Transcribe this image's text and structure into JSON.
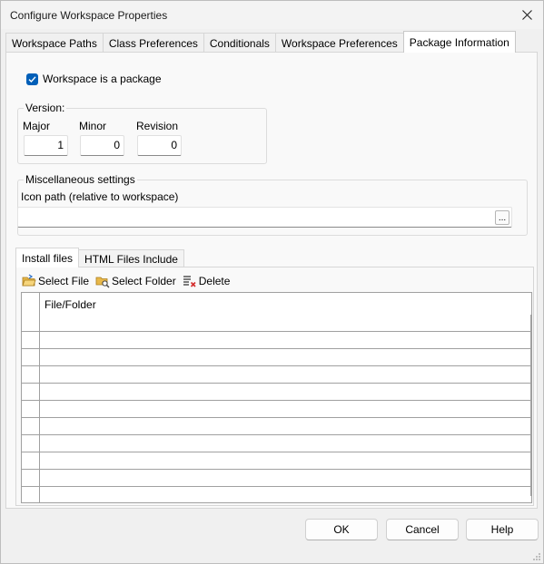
{
  "window": {
    "title": "Configure Workspace Properties"
  },
  "tabs": [
    {
      "label": "Workspace Paths",
      "active": false
    },
    {
      "label": "Class Preferences",
      "active": false
    },
    {
      "label": "Conditionals",
      "active": false
    },
    {
      "label": "Workspace Preferences",
      "active": false
    },
    {
      "label": "Package Information",
      "active": true
    }
  ],
  "package": {
    "is_package_label": "Workspace is a package",
    "is_package_checked": true
  },
  "version": {
    "legend": "Version:",
    "major_label": "Major",
    "major_value": "1",
    "minor_label": "Minor",
    "minor_value": "0",
    "revision_label": "Revision",
    "revision_value": "0"
  },
  "misc": {
    "legend": "Miscellaneous settings",
    "icon_path_label": "Icon path (relative to workspace)",
    "icon_path_value": "",
    "browse_label": "..."
  },
  "subtabs": [
    {
      "label": "Install files",
      "active": true
    },
    {
      "label": "HTML Files Include",
      "active": false
    }
  ],
  "toolbar": {
    "select_file": "Select File",
    "select_folder": "Select Folder",
    "delete": "Delete"
  },
  "grid": {
    "column_header": "File/Folder",
    "rows": [
      "",
      "",
      "",
      "",
      "",
      "",
      "",
      "",
      "",
      ""
    ]
  },
  "buttons": {
    "ok": "OK",
    "cancel": "Cancel",
    "help": "Help"
  },
  "colors": {
    "accent": "#005fb8",
    "background": "#f0f0f0",
    "panel": "#f9f9f9"
  }
}
